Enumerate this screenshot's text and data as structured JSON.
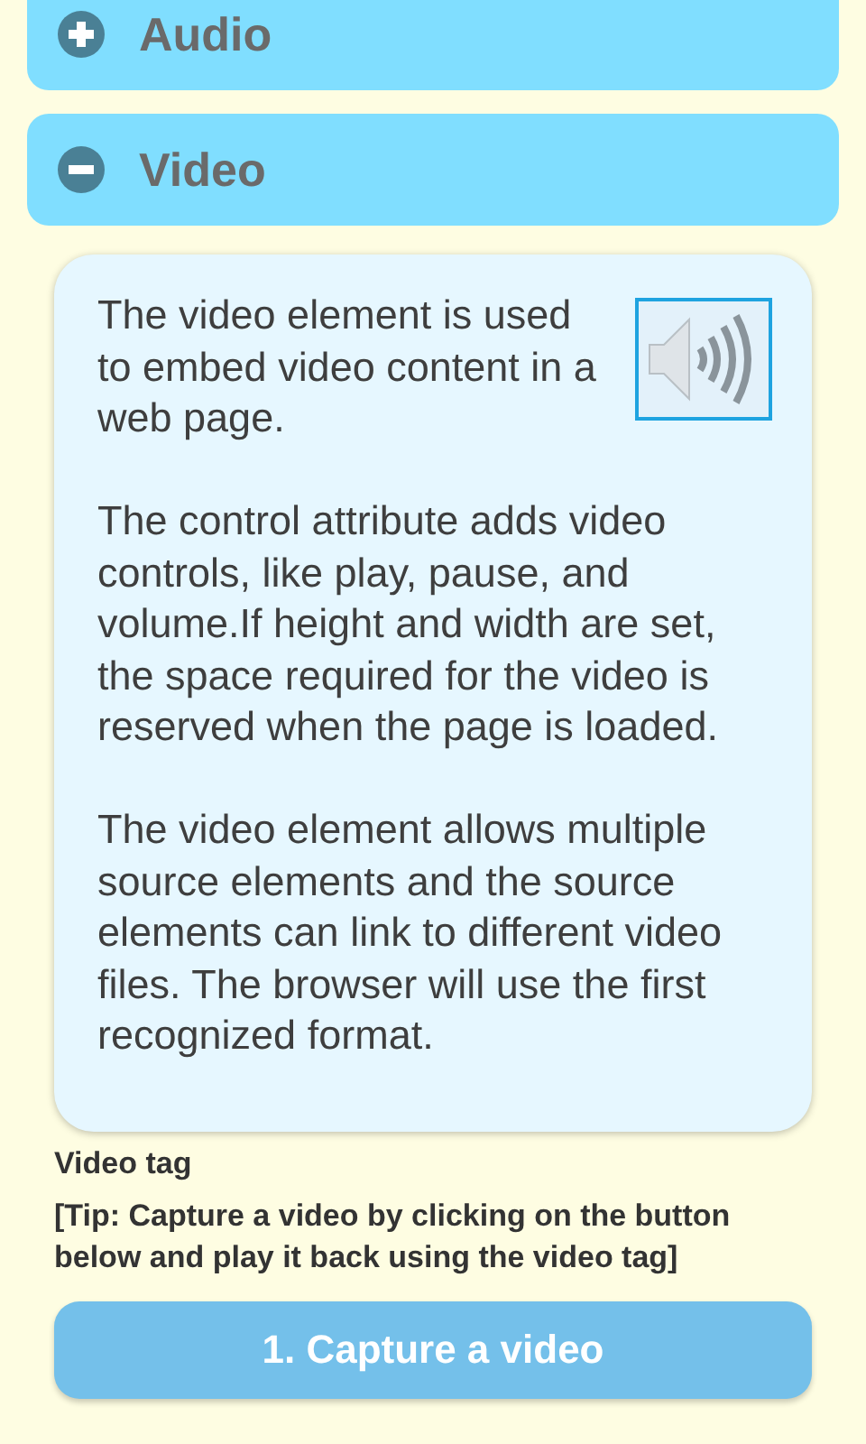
{
  "sections": [
    {
      "title": "Audio",
      "expanded": false
    },
    {
      "title": "Video",
      "expanded": true,
      "paragraphs": [
        "The video element is used to embed video content in a web page.",
        "The control attribute adds video controls, like play, pause, and volume.If height and width are set, the space required for the video is reserved when the page is loaded.",
        "The video element allows multiple source elements and the source elements can link to different video files. The browser will use the first recognized format."
      ],
      "label": "Video tag",
      "tip": "[Tip: Capture a video by clicking on the button below and play it back using the video tag]",
      "buttons": [
        "1. Capture a video"
      ]
    }
  ]
}
